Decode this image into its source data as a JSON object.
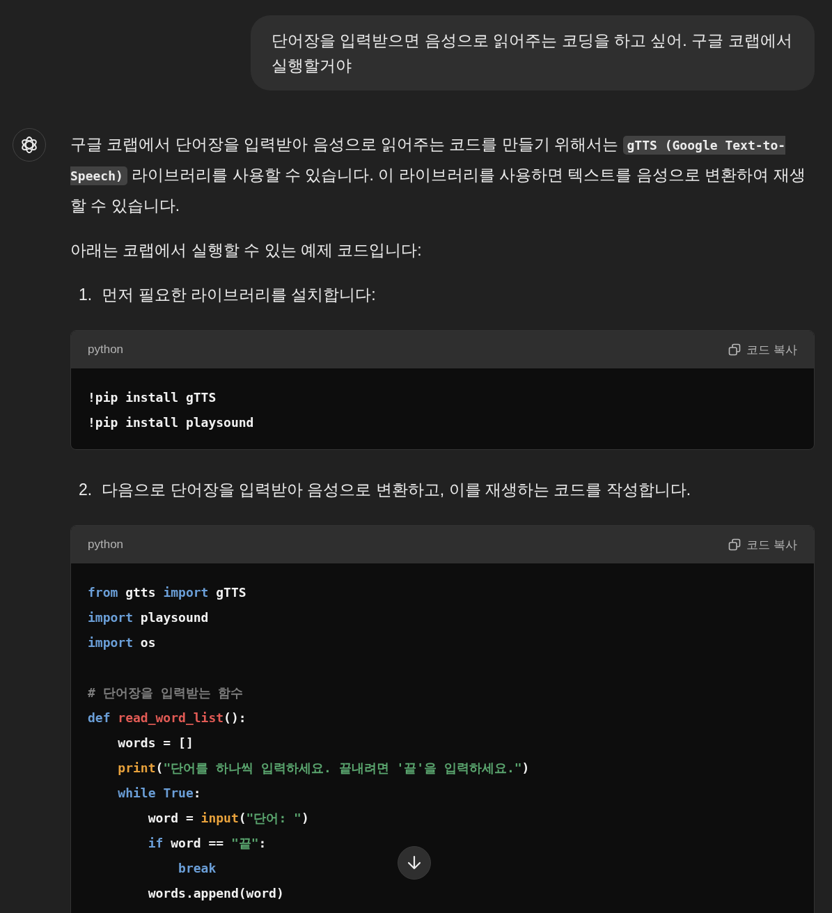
{
  "user_message": {
    "text": "단어장을 입력받으면 음성으로 읽어주는 코딩을 하고 싶어. 구글 코랩에서 실행할거야"
  },
  "assistant": {
    "blocks": [
      {
        "kind": "paragraph",
        "parts": [
          {
            "kind": "text",
            "text": "구글 코랩에서 단어장을 입력받아 음성으로 읽어주는 코드를 만들기 위해서는 "
          },
          {
            "kind": "code",
            "text": "gTTS (Google Text-to-Speech)"
          },
          {
            "kind": "text",
            "text": " 라이브러리를 사용할 수 있습니다. 이 라이브러리를 사용하면 텍스트를 음성으로 변환하여 재생할 수 있습니다."
          }
        ]
      },
      {
        "kind": "paragraph",
        "parts": [
          {
            "kind": "text",
            "text": "아래는 코랩에서 실행할 수 있는 예제 코드입니다:"
          }
        ]
      },
      {
        "kind": "step",
        "number": "1.",
        "text": "먼저 필요한 라이브러리를 설치합니다:"
      },
      {
        "kind": "codeblock",
        "language": "python",
        "copy_label": "코드 복사",
        "lines": [
          {
            "kind": "code",
            "tokens": [
              {
                "kind": "plain",
                "text": "!pip install gTTS"
              }
            ]
          },
          {
            "kind": "code",
            "tokens": [
              {
                "kind": "plain",
                "text": "!pip install playsound"
              }
            ]
          }
        ]
      },
      {
        "kind": "step",
        "number": "2.",
        "text": "다음으로 단어장을 입력받아 음성으로 변환하고, 이를 재생하는 코드를 작성합니다."
      },
      {
        "kind": "codeblock",
        "language": "python",
        "copy_label": "코드 복사",
        "lines": [
          {
            "kind": "code",
            "tokens": [
              {
                "kind": "keyword",
                "text": "from"
              },
              {
                "kind": "plain",
                "text": " gtts "
              },
              {
                "kind": "keyword",
                "text": "import"
              },
              {
                "kind": "plain",
                "text": " gTTS"
              }
            ]
          },
          {
            "kind": "code",
            "tokens": [
              {
                "kind": "keyword",
                "text": "import"
              },
              {
                "kind": "plain",
                "text": " playsound"
              }
            ]
          },
          {
            "kind": "code",
            "tokens": [
              {
                "kind": "keyword",
                "text": "import"
              },
              {
                "kind": "plain",
                "text": " os"
              }
            ]
          },
          {
            "kind": "blank"
          },
          {
            "kind": "code",
            "tokens": [
              {
                "kind": "comment",
                "text": "# 단어장을 입력받는 함수"
              }
            ]
          },
          {
            "kind": "code",
            "tokens": [
              {
                "kind": "keyword",
                "text": "def"
              },
              {
                "kind": "function",
                "text": " read_word_list"
              },
              {
                "kind": "plain",
                "text": "():"
              }
            ]
          },
          {
            "kind": "code",
            "tokens": [
              {
                "kind": "plain",
                "text": "    words = []"
              }
            ]
          },
          {
            "kind": "code",
            "tokens": [
              {
                "kind": "builtin",
                "text": "    print"
              },
              {
                "kind": "plain",
                "text": "("
              },
              {
                "kind": "string",
                "text": "\"단어를 하나씩 입력하세요. 끝내려면 '끝'을 입력하세요.\""
              },
              {
                "kind": "plain",
                "text": ")"
              }
            ]
          },
          {
            "kind": "code",
            "tokens": [
              {
                "kind": "keyword",
                "text": "    while"
              },
              {
                "kind": "keyword",
                "text": " True"
              },
              {
                "kind": "plain",
                "text": ":"
              }
            ]
          },
          {
            "kind": "code",
            "tokens": [
              {
                "kind": "plain",
                "text": "        word = "
              },
              {
                "kind": "builtin",
                "text": "input"
              },
              {
                "kind": "plain",
                "text": "("
              },
              {
                "kind": "string",
                "text": "\"단어: \""
              },
              {
                "kind": "plain",
                "text": ")"
              }
            ]
          },
          {
            "kind": "code",
            "tokens": [
              {
                "kind": "keyword",
                "text": "        if"
              },
              {
                "kind": "plain",
                "text": " word == "
              },
              {
                "kind": "string",
                "text": "\"끝\""
              },
              {
                "kind": "plain",
                "text": ":"
              }
            ]
          },
          {
            "kind": "code",
            "tokens": [
              {
                "kind": "keyword",
                "text": "            break"
              }
            ]
          },
          {
            "kind": "code",
            "tokens": [
              {
                "kind": "plain",
                "text": "        words.append(word)"
              }
            ]
          }
        ]
      }
    ]
  }
}
